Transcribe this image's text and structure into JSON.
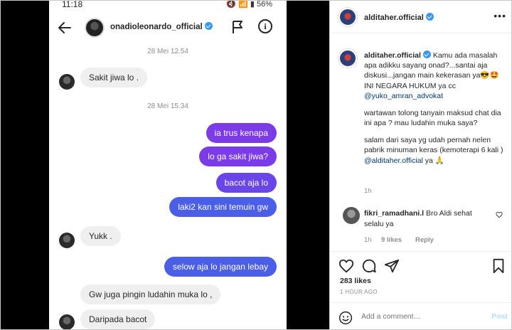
{
  "status_bar": {
    "time": "11:18",
    "battery": "56%",
    "icons": "🔇 📶 ▮"
  },
  "chat": {
    "username": "onadioleonardo_official",
    "timestamps": [
      "28 Mei 12.54",
      "28 Mei 15.34"
    ],
    "messages": [
      {
        "side": "in",
        "text": "Sakit jiwa lo ."
      },
      {
        "side": "out",
        "text": "ia trus kenapa"
      },
      {
        "side": "out",
        "text": "lo ga sakit jiwa?"
      },
      {
        "side": "out",
        "text": "bacot aja lo"
      },
      {
        "side": "out",
        "text": "laki2 kan sini temuin gw"
      },
      {
        "side": "in",
        "text": "Yukk ."
      },
      {
        "side": "out",
        "text": "selow aja lo jangan lebay"
      },
      {
        "side": "in",
        "text": "Gw juga pingin ludahin muka lo ,"
      },
      {
        "side": "in",
        "text": "Daripada bacot"
      }
    ]
  },
  "post": {
    "author": "alditaher.official",
    "more": "•••",
    "caption_parts": {
      "p1_text": " Kamu ada masalah apa adikku sayang onad?...santai aja diskusi...jangan main kekerasan ya😎🤩INI NEGARA HUKUM ya cc ",
      "p1_tag": "@yuko_amran_advokat",
      "p2": "wartawan tolong tanyain maksud chat dia ini apa ? mau ludahin muka saya?",
      "p3_text": "salam dari saya yg udah pernah nelen pabrik minuman keras (kemoterapi 6 kali ) ",
      "p3_tag": "@alditaher.official",
      "p3_end": " ya 🙏"
    },
    "caption_time": "1h",
    "comment": {
      "user": "fikri_ramadhani.l",
      "text": " Bro Aldi sehat selalu ya",
      "time": "1h",
      "likes": "9 likes",
      "reply": "Reply"
    },
    "likes": "283 likes",
    "ago": "1 HOUR AGO",
    "add_comment_placeholder": "Add a comment…",
    "post_label": "Post"
  }
}
